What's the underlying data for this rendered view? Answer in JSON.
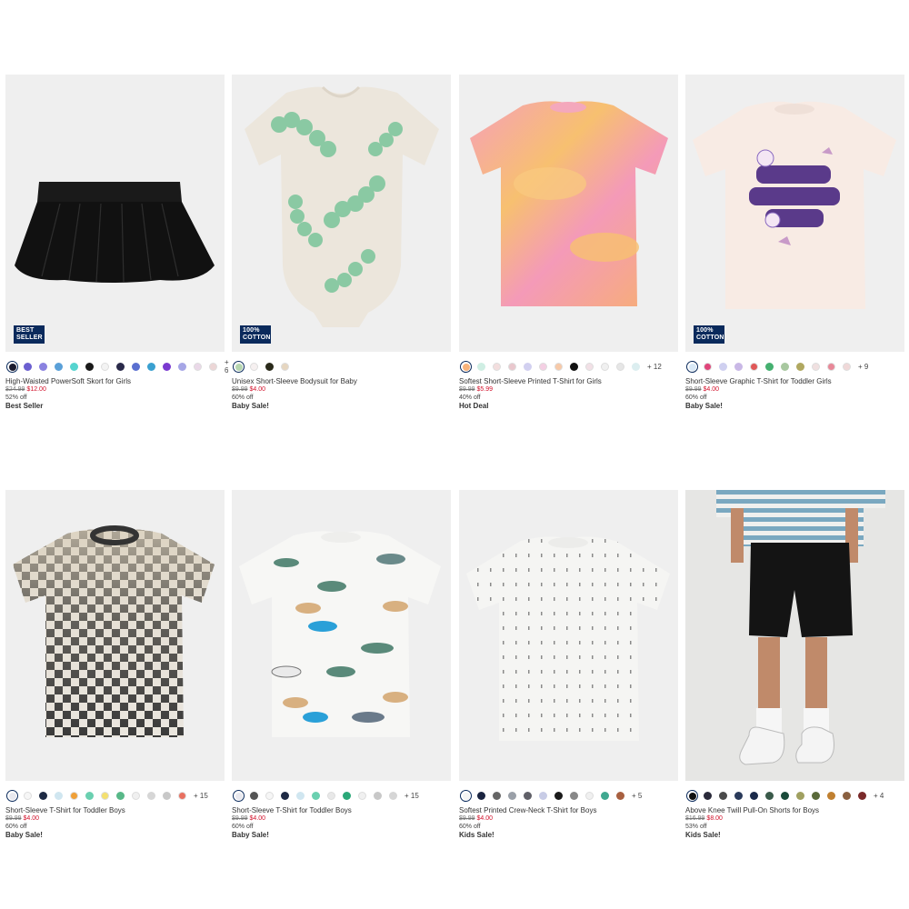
{
  "products": [
    {
      "name": "High-Waisted PowerSoft Skort for Girls",
      "orig_price": "$24.99",
      "sale_price": "$12.00",
      "discount": "52% off",
      "promo": "Best Seller",
      "badge": "BEST\nSELLER",
      "swatches": [
        "#1b1b2e",
        "#6b5fd0",
        "#8a82e0",
        "#5aa0d8",
        "#55d4cf",
        "#1a1a1a",
        "#f3f3f3",
        "#2a2a4a",
        "#5a6fd0",
        "#3aa0d0",
        "#7a3ad0",
        "#a6a6e6",
        "#ead8e8",
        "#ecd6d6"
      ],
      "more": "+ 6"
    },
    {
      "name": "Unisex Short-Sleeve Bodysuit for Baby",
      "orig_price": "$9.99",
      "sale_price": "$4.00",
      "discount": "60% off",
      "promo": "Baby Sale!",
      "badge": "100%\nCOTTON",
      "swatches": [
        "#b6d6b0",
        "#f6f0f0",
        "#2a2a1a",
        "#e6d6c0"
      ],
      "more": ""
    },
    {
      "name": "Softest Short-Sleeve Printed T-Shirt for Girls",
      "orig_price": "$9.99",
      "sale_price": "$5.99",
      "discount": "40% off",
      "promo": "Hot Deal",
      "badge": "",
      "swatches": [
        "#f7b27a",
        "#cfeee3",
        "#f3dede",
        "#e9c7cd",
        "#d2d0f0",
        "#f4cfe3",
        "#f7c9a8",
        "#111111",
        "#f2e0e6",
        "#f0f0f0",
        "#e6e6e6",
        "#dceef0"
      ],
      "more": "+ 12"
    },
    {
      "name": "Short-Sleeve Graphic T-Shirt for Toddler Girls",
      "orig_price": "$9.99",
      "sale_price": "$4.00",
      "discount": "60% off",
      "promo": "Baby Sale!",
      "badge": "100%\nCOTTON",
      "swatches": [
        "#d8e8f6",
        "#e0457a",
        "#cfd0f0",
        "#c9b8e6",
        "#e05858",
        "#45b070",
        "#a8c8a0",
        "#b0a860",
        "#f0e0e0",
        "#e88898",
        "#f0d8d8"
      ],
      "more": "+ 9"
    },
    {
      "name": "Short-Sleeve T-Shirt for Toddler Boys",
      "orig_price": "$9.99",
      "sale_price": "$4.00",
      "discount": "60% off",
      "promo": "Baby Sale!",
      "badge": "",
      "swatches": [
        "#e8e8ee",
        "#f6f6f6",
        "#1e2a44",
        "#d0e6f0",
        "#f0a038",
        "#6ad0b0",
        "#f4e070",
        "#58b888",
        "#f0f0f0",
        "#d6d6d6",
        "#c8c8c8",
        "#e87060"
      ],
      "more": "+ 15"
    },
    {
      "name": "Short-Sleeve T-Shirt for Toddler Boys",
      "orig_price": "$9.99",
      "sale_price": "$4.00",
      "discount": "60% off",
      "promo": "Baby Sale!",
      "badge": "",
      "swatches": [
        "#e8e8ee",
        "#555555",
        "#f6f6f6",
        "#1e2a44",
        "#d0e6f0",
        "#6ad0b0",
        "#e8e8e8",
        "#2aa878",
        "#f0f0f0",
        "#c8c8c8",
        "#d6d6d6"
      ],
      "more": "+ 15"
    },
    {
      "name": "Softest Printed Crew-Neck T-Shirt for Boys",
      "orig_price": "$9.99",
      "sale_price": "$4.00",
      "discount": "60% off",
      "promo": "Kids Sale!",
      "badge": "",
      "swatches": [
        "#f4f4f4",
        "#1a2440",
        "#666666",
        "#9aa0a8",
        "#606068",
        "#c8cce6",
        "#1a1a1a",
        "#888888",
        "#f0f0f0",
        "#40a890",
        "#a86040"
      ],
      "more": "+ 5"
    },
    {
      "name": "Above Knee Twill Pull-On Shorts for Boys",
      "orig_price": "$16.99",
      "sale_price": "$8.00",
      "discount": "53% off",
      "promo": "Kids Sale!",
      "badge": "",
      "swatches": [
        "#111111",
        "#2a2a3a",
        "#4a4a4a",
        "#2a3a5a",
        "#1a2a4a",
        "#3a5a4a",
        "#1a4a3a",
        "#a0a060",
        "#5a6a3a",
        "#c08030",
        "#8a6040",
        "#7a2a2a"
      ],
      "more": "+ 4"
    }
  ]
}
